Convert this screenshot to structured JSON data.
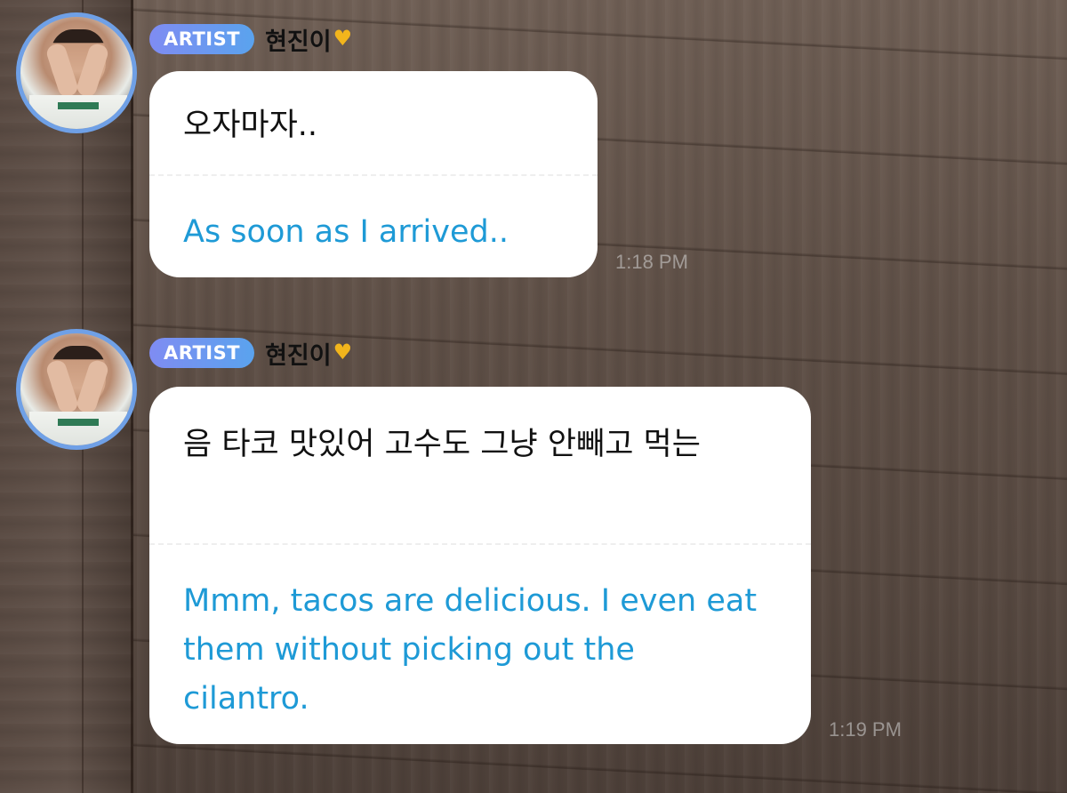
{
  "messages": [
    {
      "badge": "ARTIST",
      "author": "현진이",
      "author_icon": "heart-hands-icon",
      "original": "오자마자..",
      "translation": "As soon as I arrived..",
      "time": "1:18 PM"
    },
    {
      "badge": "ARTIST",
      "author": "현진이",
      "author_icon": "heart-hands-icon",
      "original": "음 타코 맛있어 고수도 그냥 안빼고 먹는",
      "translation": "Mmm, tacos are delicious. I even eat them without picking out the cilantro.",
      "time": "1:19 PM"
    }
  ],
  "colors": {
    "badge_gradient_start": "#7f8cf2",
    "badge_gradient_end": "#5aa3ee",
    "translation_text": "#1e9ad6",
    "avatar_ring": "#6fa0e6",
    "bubble_bg": "#ffffff"
  }
}
